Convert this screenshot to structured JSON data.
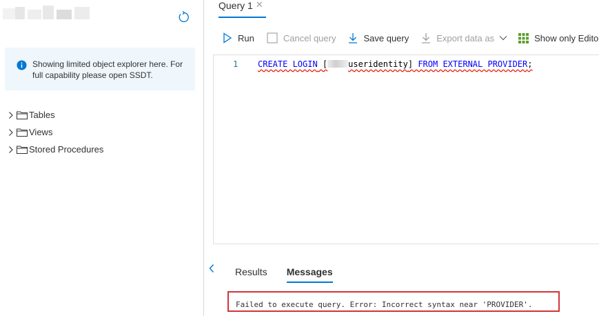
{
  "explorer": {
    "info_message": "Showing limited object explorer here. For full capability please open SSDT.",
    "tree_items": [
      {
        "label": "Tables"
      },
      {
        "label": "Views"
      },
      {
        "label": "Stored Procedures"
      }
    ]
  },
  "query_tab": {
    "title": "Query 1"
  },
  "toolbar": {
    "run_label": "Run",
    "cancel_label": "Cancel query",
    "save_label": "Save query",
    "export_label": "Export data as",
    "show_editor_label": "Show only Editor"
  },
  "editor": {
    "line_number": "1",
    "code": {
      "kw1": "CREATE LOGIN",
      "bracket_open": " [",
      "ident_visible": "useridentity",
      "bracket_close": "]",
      "kw2": " FROM EXTERNAL PROVIDER",
      "semicolon": ";"
    }
  },
  "results": {
    "tabs": [
      "Results",
      "Messages"
    ],
    "active_tab": "Messages",
    "message": "Failed to execute query. Error: Incorrect syntax near 'PROVIDER'."
  },
  "colors": {
    "accent": "#0078d4",
    "error_border": "#d13438",
    "keyword": "#0000ff",
    "info_background": "#eff6fc"
  }
}
